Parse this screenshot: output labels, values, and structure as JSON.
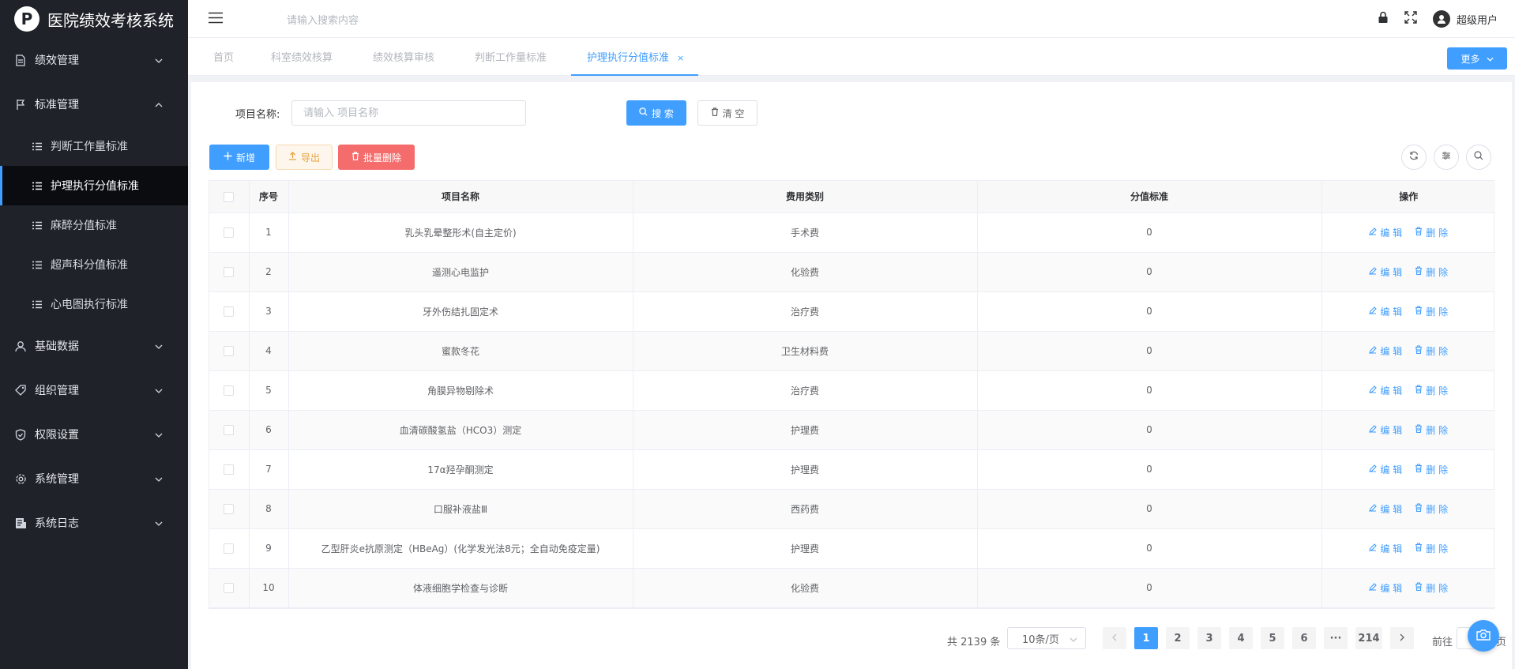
{
  "app": {
    "title": "医院绩效考核系统",
    "logo_glyph": "P"
  },
  "sidebar": {
    "menus": [
      {
        "label": "绩效管理",
        "icon": "document-icon",
        "expanded": false
      },
      {
        "label": "标准管理",
        "icon": "flag-icon",
        "expanded": true,
        "children": [
          {
            "label": "判断工作量标准"
          },
          {
            "label": "护理执行分值标准",
            "active": true
          },
          {
            "label": "麻醉分值标准"
          },
          {
            "label": "超声科分值标准"
          },
          {
            "label": "心电图执行标准"
          }
        ]
      },
      {
        "label": "基础数据",
        "icon": "user-icon",
        "expanded": false
      },
      {
        "label": "组织管理",
        "icon": "tag-icon",
        "expanded": false
      },
      {
        "label": "权限设置",
        "icon": "shield-check-icon",
        "expanded": false
      },
      {
        "label": "系统管理",
        "icon": "gear-icon",
        "expanded": false
      },
      {
        "label": "系统日志",
        "icon": "log-icon",
        "expanded": false
      }
    ]
  },
  "header": {
    "search_placeholder": "请输入搜索内容",
    "username": "超级用户"
  },
  "tabs": {
    "items": [
      {
        "label": "首页"
      },
      {
        "label": "科室绩效核算"
      },
      {
        "label": "绩效核算审核"
      },
      {
        "label": "判断工作量标准"
      },
      {
        "label": "护理执行分值标准",
        "active": true,
        "close": "×"
      }
    ],
    "more_label": "更多"
  },
  "filter": {
    "label": "项目名称:",
    "placeholder": "请输入 项目名称",
    "search_label": "搜 索",
    "clear_label": "清 空"
  },
  "toolbar": {
    "add_label": "新增",
    "export_label": "导出",
    "batch_delete_label": "批量删除"
  },
  "table": {
    "headers": {
      "index": "序号",
      "name": "项目名称",
      "category": "费用类别",
      "score": "分值标准",
      "ops": "操作"
    },
    "edit_label": "编 辑",
    "delete_label": "删 除",
    "rows": [
      {
        "index": "1",
        "name": "乳头乳晕整形术(自主定价)",
        "category": "手术费",
        "score": "0"
      },
      {
        "index": "2",
        "name": "遥测心电监护",
        "category": "化验费",
        "score": "0"
      },
      {
        "index": "3",
        "name": "牙外伤结扎固定术",
        "category": "治疗费",
        "score": "0"
      },
      {
        "index": "4",
        "name": "蜜款冬花",
        "category": "卫生材料费",
        "score": "0"
      },
      {
        "index": "5",
        "name": "角膜异物剔除术",
        "category": "治疗费",
        "score": "0"
      },
      {
        "index": "6",
        "name": "血清碳酸氢盐（HCO3）测定",
        "category": "护理费",
        "score": "0"
      },
      {
        "index": "7",
        "name": "17α羟孕酮测定",
        "category": "护理费",
        "score": "0"
      },
      {
        "index": "8",
        "name": "口服补液盐Ⅲ",
        "category": "西药费",
        "score": "0"
      },
      {
        "index": "9",
        "name": "乙型肝炎e抗原测定（HBeAg）(化学发光法8元；全自动免疫定量)",
        "category": "护理费",
        "score": "0"
      },
      {
        "index": "10",
        "name": "体液细胞学检查与诊断",
        "category": "化验费",
        "score": "0"
      }
    ]
  },
  "pagination": {
    "total_text": "共 2139 条",
    "page_size": "10条/页",
    "pages": [
      "1",
      "2",
      "3",
      "4",
      "5",
      "6",
      "···",
      "214"
    ],
    "current": "1",
    "goto_prefix": "前往",
    "goto_suffix": "页"
  },
  "colors": {
    "primary": "#409eff",
    "sidebar_bg": "#1f2329",
    "danger": "#f56c6c",
    "warning": "#e6a23c"
  }
}
